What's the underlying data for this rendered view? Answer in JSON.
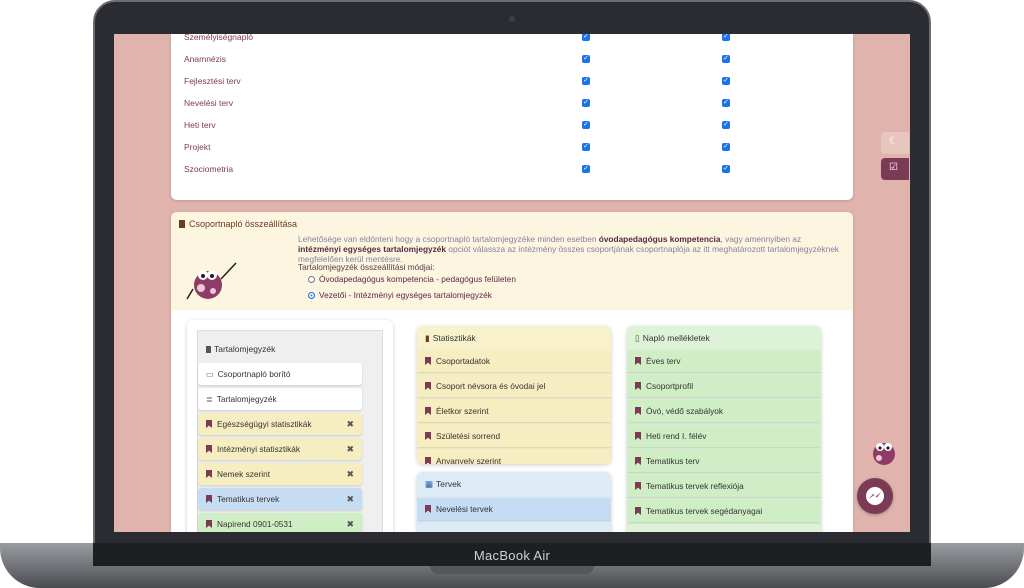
{
  "device_label": "MacBook Air",
  "permissions": {
    "rows": [
      {
        "label": "Személyiségnapló"
      },
      {
        "label": "Anamnézis"
      },
      {
        "label": "Fejlesztési terv"
      },
      {
        "label": "Nevelési terv"
      },
      {
        "label": "Heti terv"
      },
      {
        "label": "Projekt"
      },
      {
        "label": "Szociometria"
      }
    ]
  },
  "assembly": {
    "title": "Csoportnapló összeállítása",
    "intro_before": "Lehetősége van eldönteni hogy a csoportnapló tartalomjegyzéke minden esetben ",
    "intro_bold1": "óvodapedagógus kompetencia",
    "intro_mid": ", vagy amennyiben az ",
    "intro_bold2": "intézményi egységes tartalomjegyzék",
    "intro_after": " opciót válassza az intézmény összes csoportjának csoportnaplója az itt meghatározott tartalomjegyzéknek megfelelően kerül mentésre.",
    "mode_title": "Tartalomjegyzék összeállítási módjai:",
    "options": [
      {
        "label": "Óvodapedagógus kompetencia - pedagógus felületen",
        "selected": false
      },
      {
        "label": "Vezetői - Intézményi egységes tartalomjegyzék",
        "selected": true
      }
    ]
  },
  "toc": {
    "title": "Tartalomjegyzék",
    "items": [
      {
        "label": "Csoportnapló borító",
        "color": "white",
        "removable": false
      },
      {
        "label": "Tartalomjegyzék",
        "color": "white",
        "removable": false
      },
      {
        "label": "Egészségügyi statisztikák",
        "color": "yellow",
        "removable": true
      },
      {
        "label": "Intézményi statisztikák",
        "color": "yellow",
        "removable": true
      },
      {
        "label": "Nemek szerint",
        "color": "yellow",
        "removable": true
      },
      {
        "label": "Tematikus tervek",
        "color": "blue",
        "removable": true
      },
      {
        "label": "Napirend 0901-0531",
        "color": "green",
        "removable": true
      }
    ],
    "remove_glyph": "✖"
  },
  "stats": {
    "title": "Statisztikák",
    "items": [
      "Csoportadatok",
      "Csoport névsora és óvodai jel",
      "Életkor szerint",
      "Születési sorrend",
      "Anyanyelv szerint"
    ]
  },
  "plans": {
    "title": "Tervek",
    "items": [
      "Nevelési tervek"
    ]
  },
  "attachments": {
    "title": "Napló mellékletek",
    "items": [
      "Éves terv",
      "Csoportprofil",
      "Óvó, védő szabályok",
      "Heti rend I. félév",
      "Tematikus terv",
      "Tematikus tervek reflexiója",
      "Tematikus tervek segédanyagai"
    ]
  },
  "colors": {
    "brand": "#7b3b55",
    "page_bg": "#e0b4ad"
  }
}
